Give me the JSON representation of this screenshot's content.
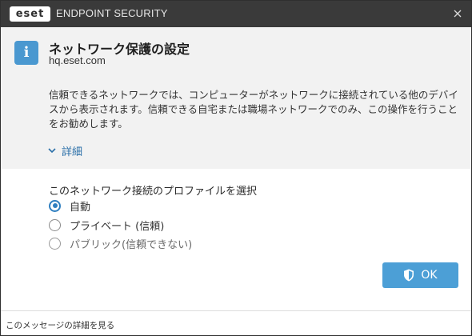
{
  "window": {
    "brand": "eset",
    "app_title": "ENDPOINT SECURITY"
  },
  "dialog": {
    "title": "ネットワーク保護の設定",
    "subtitle": "hq.eset.com",
    "description": "信頼できるネットワークでは、コンピューターがネットワークに接続されている他のデバイスから表示されます。信頼できる自宅または職場ネットワークでのみ、この操作を行うことをお勧めします。",
    "details_label": "詳細"
  },
  "profile": {
    "label": "このネットワーク接続のプロファイルを選択",
    "options": [
      {
        "label": "自動",
        "selected": true
      },
      {
        "label": "プライベート (信頼)",
        "selected": false
      },
      {
        "label": "パブリック(信頼できない)",
        "selected": false
      }
    ]
  },
  "buttons": {
    "ok_label": "OK"
  },
  "footer": {
    "link_label": "このメッセージの詳細を見る"
  },
  "icons": {
    "info": "info-icon",
    "close": "close-icon",
    "chevron": "chevron-down-icon",
    "shield": "shield-icon"
  },
  "colors": {
    "titlebar": "#3a3a3a",
    "accent": "#4c9fd6",
    "panel": "#f2f2f2",
    "link": "#2a6fa8"
  }
}
